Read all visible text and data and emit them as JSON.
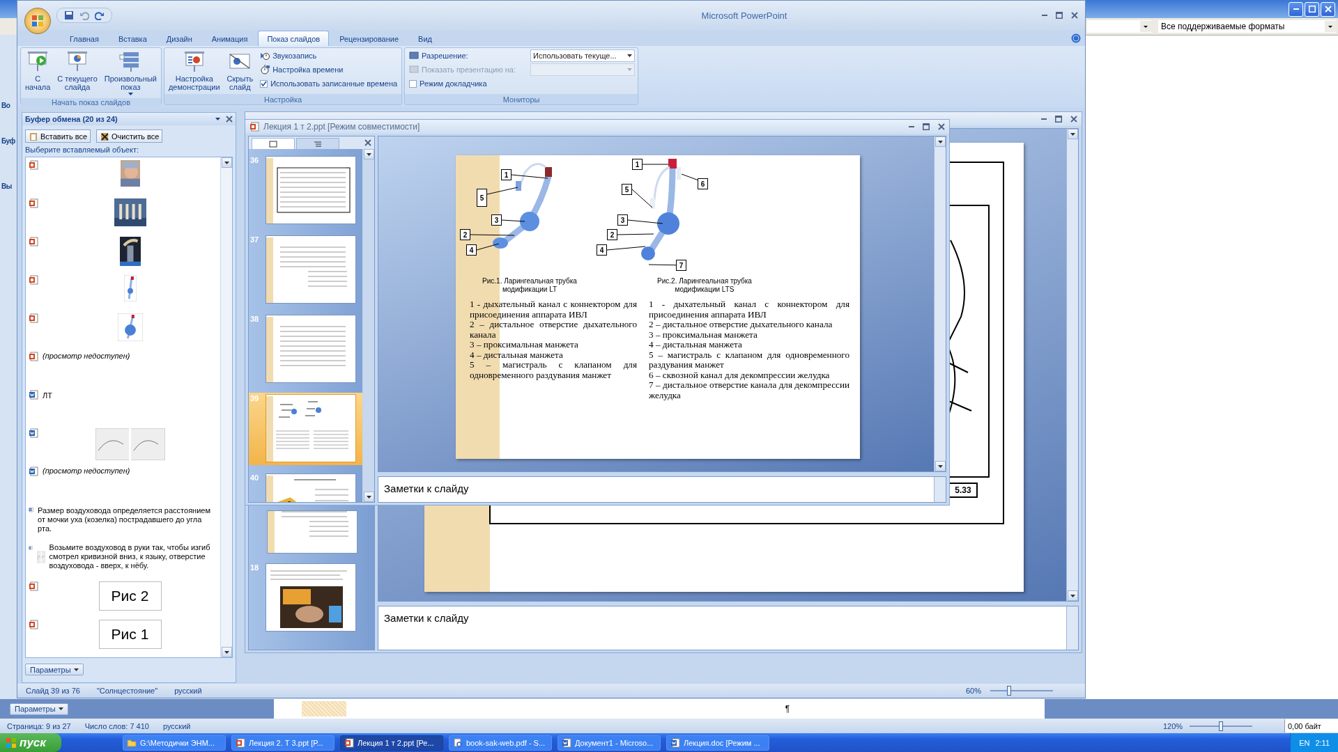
{
  "background_window": {
    "filter": "Все поддерживаемые форматы",
    "cut_labels": [
      "Во",
      "Буф",
      "Вы"
    ],
    "options_button": "Параметры",
    "pilcrow": "¶",
    "status_bar": {
      "items": [
        "Страница: 9 из 27",
        "Число слов: 7 410",
        "русский"
      ],
      "zoom": "120%",
      "level": 0.5,
      "size": "0,00 байт"
    }
  },
  "powerpoint": {
    "title": "Microsoft PowerPoint",
    "tabs": [
      {
        "label": "Главная",
        "selected": false
      },
      {
        "label": "Вставка",
        "selected": false
      },
      {
        "label": "Дизайн",
        "selected": false
      },
      {
        "label": "Анимация",
        "selected": false
      },
      {
        "label": "Показ слайдов",
        "selected": true
      },
      {
        "label": "Рецензирование",
        "selected": false
      },
      {
        "label": "Вид",
        "selected": false
      }
    ],
    "ribbon_groups": [
      {
        "label": "Начать показ слайдов",
        "controls": [
          {
            "kind": "large",
            "label": "С\nначала"
          },
          {
            "kind": "large",
            "label": "С текущего\nслайда"
          },
          {
            "kind": "large",
            "label": "Произвольный\nпоказ",
            "menu": true
          }
        ]
      },
      {
        "label": "Настройка",
        "controls": [
          {
            "kind": "large",
            "label": "Настройка\nдемонстрации"
          },
          {
            "kind": "large",
            "label": "Скрыть\nслайд"
          },
          {
            "kind": "small",
            "label": "Звукозапись"
          },
          {
            "kind": "small",
            "label": "Настройка времени"
          },
          {
            "kind": "check",
            "label": "Использовать записанные времена",
            "checked": true
          }
        ]
      },
      {
        "label": "Мониторы",
        "controls": [
          {
            "kind": "field",
            "label": "Разрешение:",
            "value": "Использовать текуще...",
            "disabled": false
          },
          {
            "kind": "field",
            "label": "Показать презентацию на:",
            "disabled": true
          },
          {
            "kind": "check",
            "label": "Режим докладчика",
            "checked": false
          }
        ]
      }
    ],
    "clipboard": {
      "title": "Буфер обмена (20 из 24)",
      "buttons": [
        "Вставить все",
        "Очистить все"
      ],
      "prompt": "Выберите вставляемый объект:",
      "items": [
        {
          "kind": "picture"
        },
        {
          "kind": "picture"
        },
        {
          "kind": "picture"
        },
        {
          "kind": "picture"
        },
        {
          "kind": "picture"
        },
        {
          "kind": "note",
          "text": "(просмотр недоступен)"
        },
        {
          "kind": "text",
          "text": "ЛТ"
        },
        {
          "kind": "picture"
        },
        {
          "kind": "note",
          "text": "(просмотр недоступен)"
        },
        {
          "kind": "text",
          "text": "Размер воздуховода определяется расстоянием от мочки уха (козелка) пострадавшего до угла рта."
        },
        {
          "kind": "text_picture",
          "text": "Возьмите воздуховод в руки так, чтобы изгиб смотрел кривизной вниз, к языку, отверстие воздуховода - вверх, к нёбу."
        },
        {
          "kind": "caption",
          "text": "Рис 2"
        },
        {
          "kind": "caption",
          "text": "Рис 1"
        }
      ],
      "options_button": "Параметры"
    },
    "document": {
      "title": "Лекция 1 т 2.ppt [Режим совместимости]",
      "thumbnails": [
        {
          "number": "36",
          "selected": false
        },
        {
          "number": "37",
          "selected": false
        },
        {
          "number": "38",
          "selected": false
        },
        {
          "number": "39",
          "selected": true
        },
        {
          "number": "40",
          "selected": false
        }
      ],
      "slide": {
        "figures": [
          {
            "callouts": [
              "1",
              "5",
              "3",
              "2",
              "4"
            ],
            "caption": "Рис.1. Ларингеальная трубка модификации LT"
          },
          {
            "callouts": [
              "1",
              "6",
              "5",
              "3",
              "2",
              "4",
              "7"
            ],
            "caption": "Рис.2. Ларингеальная трубка модификации LTS"
          }
        ],
        "legends": [
          [
            "1 - дыхательный канал с коннектором для присоединения аппарата ИВЛ",
            "2 – дистальное отверстие дыхательного канала",
            "3 – проксимальная манжета",
            "4 – дистальная манжета",
            "5 – магистраль с клапаном для одновременного раздувания манжет"
          ],
          [
            "1 - дыхательный канал с коннектором для присоединения аппарата ИВЛ",
            "2 – дистальное отверстие дыхательного канала",
            "3 – проксимальная манжета",
            "4 – дистальная манжета",
            "5 – магистраль с клапаном для одновременного раздувания манжет",
            "6 – сквозной канал для декомпрессии желудка",
            "7 – дистальное отверстие канала для декомпрессии желудка"
          ]
        ]
      },
      "notes": "Заметки к слайду"
    },
    "back_document": {
      "thumbnails": [
        {
          "kind": "text"
        },
        {
          "kind": "picture",
          "number": "18"
        }
      ],
      "figure_label": "5.33",
      "notes": "Заметки к слайду"
    },
    "status_bar": {
      "items": [
        "Слайд 39 из 76",
        "\"Солнцестояние\"",
        "русский"
      ],
      "zoom": "60%",
      "level": 0.3
    }
  },
  "taskbar": {
    "start": "пуск",
    "items": [
      {
        "kind": "folder",
        "label": "G:\\Методички ЭНМ...",
        "selected": false
      },
      {
        "kind": "presentation",
        "label": "Лекция 2. Т 3.ppt [Р...",
        "selected": false
      },
      {
        "kind": "presentation",
        "label": "Лекция 1 т 2.ppt [Ре...",
        "selected": true
      },
      {
        "kind": "pdf",
        "label": "book-sak-web.pdf - S...",
        "selected": false
      },
      {
        "kind": "document",
        "label": "Документ1 - Microso...",
        "selected": false
      },
      {
        "kind": "document",
        "label": "Лекция.doc [Режим ...",
        "selected": false
      }
    ],
    "language": "EN",
    "clock": "2:11"
  }
}
